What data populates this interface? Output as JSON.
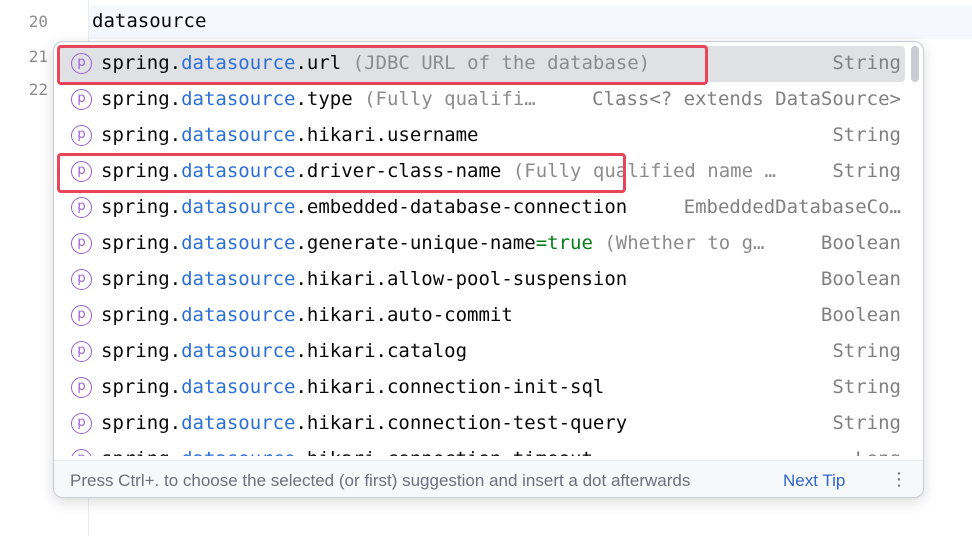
{
  "editor": {
    "lines": [
      {
        "number": "20",
        "code": "datasource"
      },
      {
        "number": "21",
        "code": ""
      },
      {
        "number": "22",
        "code": ""
      }
    ]
  },
  "completion": {
    "icon_letter": "p",
    "items": [
      {
        "prefix": "spring.",
        "highlight": "datasource",
        "suffix": ".url",
        "value": "",
        "description": " (JDBC URL of the database)",
        "type": "String",
        "selected": true
      },
      {
        "prefix": "spring.",
        "highlight": "datasource",
        "suffix": ".type",
        "value": "",
        "description": " (Fully qualifi…",
        "type": "Class<? extends DataSource>",
        "selected": false
      },
      {
        "prefix": "spring.",
        "highlight": "datasource",
        "suffix": ".hikari.username",
        "value": "",
        "description": "",
        "type": "String",
        "selected": false
      },
      {
        "prefix": "spring.",
        "highlight": "datasource",
        "suffix": ".driver-class-name",
        "value": "",
        "description": " (Fully qualified name …",
        "type": "String",
        "selected": false
      },
      {
        "prefix": "spring.",
        "highlight": "datasource",
        "suffix": ".embedded-database-connection",
        "value": "",
        "description": "",
        "type": "EmbeddedDatabaseCo…",
        "selected": false
      },
      {
        "prefix": "spring.",
        "highlight": "datasource",
        "suffix": ".generate-unique-name",
        "value": "=true",
        "description": " (Whether to g…",
        "type": "Boolean",
        "selected": false
      },
      {
        "prefix": "spring.",
        "highlight": "datasource",
        "suffix": ".hikari.allow-pool-suspension",
        "value": "",
        "description": "",
        "type": "Boolean",
        "selected": false
      },
      {
        "prefix": "spring.",
        "highlight": "datasource",
        "suffix": ".hikari.auto-commit",
        "value": "",
        "description": "",
        "type": "Boolean",
        "selected": false
      },
      {
        "prefix": "spring.",
        "highlight": "datasource",
        "suffix": ".hikari.catalog",
        "value": "",
        "description": "",
        "type": "String",
        "selected": false
      },
      {
        "prefix": "spring.",
        "highlight": "datasource",
        "suffix": ".hikari.connection-init-sql",
        "value": "",
        "description": "",
        "type": "String",
        "selected": false
      },
      {
        "prefix": "spring.",
        "highlight": "datasource",
        "suffix": ".hikari.connection-test-query",
        "value": "",
        "description": "",
        "type": "String",
        "selected": false
      },
      {
        "prefix": "spring.",
        "highlight": "datasource",
        "suffix": ".hikari.connection-timeout",
        "value": "",
        "description": "",
        "type": "Long",
        "selected": false
      }
    ],
    "footer": {
      "hint": "Press Ctrl+. to choose the selected (or first) suggestion and insert a dot afterwards",
      "next_tip": "Next Tip",
      "more_icon": "more-vertical-icon"
    }
  },
  "colors": {
    "highlight": "#2a6fd6",
    "annotation_border": "#e8455a",
    "property_icon": "#9b5fd6"
  }
}
